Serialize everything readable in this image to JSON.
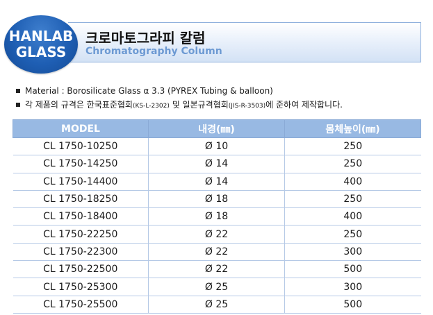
{
  "header": {
    "logo_line1": "HANLAB",
    "logo_line2": "GLASS",
    "title_korean": "크로마토그라피 칼럼",
    "title_english": "Chromatography Column"
  },
  "notes": {
    "material": "Material  : Borosilicate Glass α 3.3 (PYREX Tubing & balloon)",
    "standard_prefix": "각 제품의 규격은 한국표준협회",
    "standard_ks": "(KS-L-2302)",
    "standard_mid": " 및 일본규격협회",
    "standard_jis": "(JIS-R-3503)",
    "standard_suffix": "에 준하여 제작합니다."
  },
  "table": {
    "headers": [
      "MODEL",
      "내경(㎜)",
      "몸체높이(㎜)"
    ],
    "rows": [
      [
        "CL 1750-10250",
        "Ø 10",
        "250"
      ],
      [
        "CL 1750-14250",
        "Ø 14",
        "250"
      ],
      [
        "CL 1750-14400",
        "Ø 14",
        "400"
      ],
      [
        "CL 1750-18250",
        "Ø 18",
        "250"
      ],
      [
        "CL 1750-18400",
        "Ø 18",
        "400"
      ],
      [
        "CL 1750-22250",
        "Ø 22",
        "250"
      ],
      [
        "CL 1750-22300",
        "Ø 22",
        "300"
      ],
      [
        "CL 1750-22500",
        "Ø 22",
        "500"
      ],
      [
        "CL 1750-25300",
        "Ø 25",
        "300"
      ],
      [
        "CL 1750-25500",
        "Ø 25",
        "500"
      ]
    ]
  },
  "colors": {
    "header_fill": "#98b9e3",
    "logo_blue": "#1e5eb3",
    "subtitle_blue": "#6d9ad3",
    "grid_line": "#b5c9e6"
  }
}
